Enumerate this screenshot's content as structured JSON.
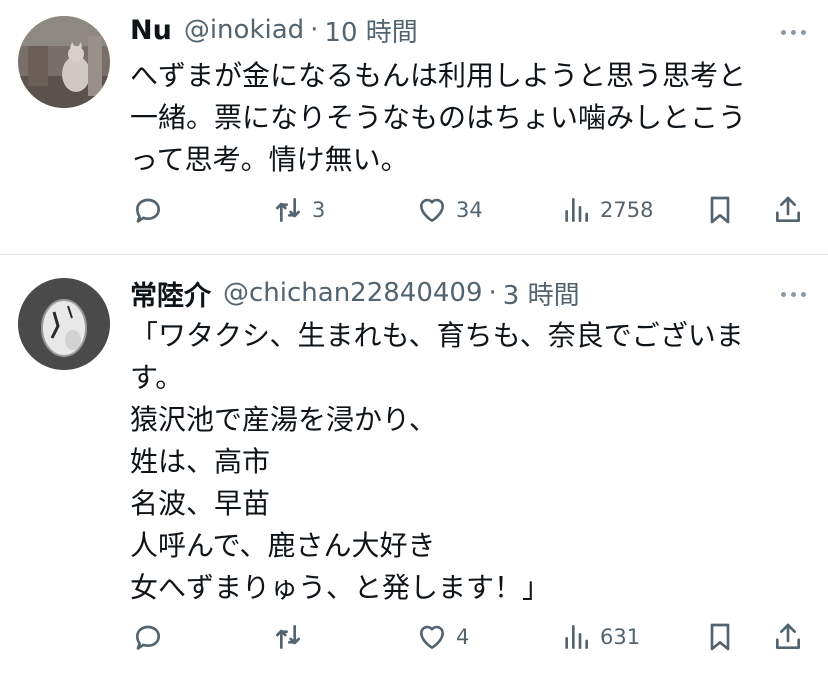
{
  "tweets": [
    {
      "display_name": "Nu",
      "handle": "@inokiad",
      "separator": "·",
      "time": "10 時間",
      "body_lines": [
        "へずまが金になるもんは利用しようと思う思考と",
        "一緒。票になりそうなものはちょい噛みしとこう",
        "って思考。情け無い。"
      ],
      "actions": {
        "reply": "",
        "retweet": "3",
        "like": "34",
        "views": "2758"
      }
    },
    {
      "display_name": "常陸介",
      "handle": "@chichan22840409",
      "separator": "·",
      "time": "3 時間",
      "body_lines": [
        "「ワタクシ、生まれも、育ちも、奈良でございま",
        "す。",
        "猿沢池で産湯を浸かり、",
        "姓は、高市",
        "名波、早苗",
        "人呼んで、鹿さん大好き",
        "女へずまりゅう、と発します！」"
      ],
      "actions": {
        "reply": "",
        "retweet": "",
        "like": "4",
        "views": "631"
      }
    }
  ],
  "icons": {
    "reply": "reply-icon",
    "retweet": "retweet-icon",
    "like": "heart-icon",
    "views": "views-icon",
    "bookmark": "bookmark-icon",
    "share": "share-icon",
    "more": "more-icon"
  },
  "colors": {
    "text": "#0f1419",
    "secondary": "#536471",
    "divider": "#e1e4e8"
  }
}
